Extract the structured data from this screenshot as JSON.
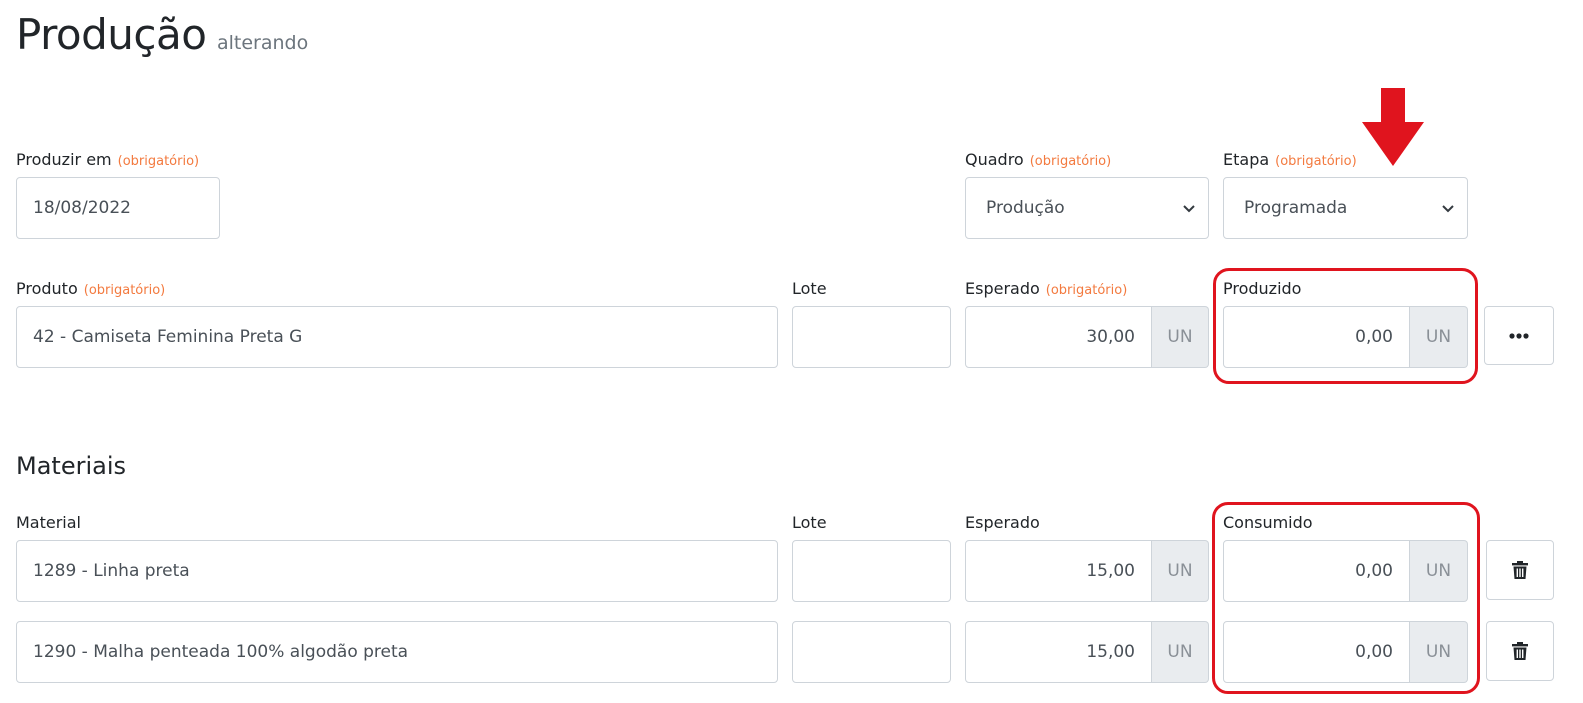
{
  "header": {
    "title": "Produção",
    "subtitle": "alterando"
  },
  "required_text": "(obrigatório)",
  "form": {
    "produzir_em": {
      "label": "Produzir em",
      "value": "18/08/2022"
    },
    "quadro": {
      "label": "Quadro",
      "value": "Produção"
    },
    "etapa": {
      "label": "Etapa",
      "value": "Programada"
    },
    "produto": {
      "label": "Produto",
      "value": "42 - Camiseta Feminina Preta G"
    },
    "lote": {
      "label": "Lote",
      "value": ""
    },
    "esperado": {
      "label": "Esperado",
      "value": "30,00",
      "unit": "UN"
    },
    "produzido": {
      "label": "Produzido",
      "value": "0,00",
      "unit": "UN"
    }
  },
  "materiais": {
    "title": "Materiais",
    "columns": {
      "material": "Material",
      "lote": "Lote",
      "esperado": "Esperado",
      "consumido": "Consumido"
    },
    "rows": [
      {
        "material": "1289 - Linha preta",
        "lote": "",
        "esperado": "15,00",
        "esperado_unit": "UN",
        "consumido": "0,00",
        "consumido_unit": "UN"
      },
      {
        "material": "1290 - Malha penteada 100% algodão preta",
        "lote": "",
        "esperado": "15,00",
        "esperado_unit": "UN",
        "consumido": "0,00",
        "consumido_unit": "UN"
      }
    ]
  },
  "colors": {
    "required": "#f37a3f",
    "annotation": "#e0141e",
    "border": "#ced4da",
    "addon_bg": "#e9ecef"
  },
  "icons": {
    "more": "ellipsis-icon",
    "delete": "trash-icon",
    "select": "chevron-down-icon",
    "annotation": "arrow-down-icon"
  }
}
